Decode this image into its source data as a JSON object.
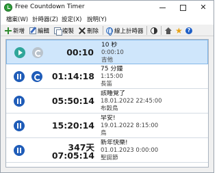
{
  "window": {
    "title": "Free Countdown Timer",
    "minimize_icon": "minimize-icon",
    "maximize_icon": "maximize-icon",
    "close_icon": "close-icon",
    "close_glyph": "✕"
  },
  "menu": {
    "items": [
      "檔案(W)",
      "計時器(Z)",
      "設定(X)",
      "說明(Y)"
    ]
  },
  "toolbar": {
    "new_label": "新增",
    "edit_label": "編輯",
    "copy_label": "複製",
    "delete_label": "刪除",
    "online_label": "線上計時器",
    "star_glyph": "★",
    "help_glyph": "?",
    "icons": [
      "plus-icon",
      "edit-icon",
      "copy-icon",
      "delete-icon",
      "globe-icon",
      "contrast-icon",
      "house-icon",
      "star-icon",
      "help-icon"
    ],
    "star_color": "#e8a317",
    "help_color": "#1e5fc7"
  },
  "timers": [
    {
      "time": "00:10",
      "name": "10 秒",
      "line2": "0:00:10",
      "line3": "吉他",
      "state": "stopped"
    },
    {
      "time": "01:14:18",
      "name": "75 分鐘",
      "line2": "1:15:00",
      "line3": "長笛",
      "state": "running"
    },
    {
      "time": "05:50:14",
      "name": "該睡覺了",
      "line2": "18.01.2022 22:45:00",
      "line3": "布穀鳥",
      "state": "running"
    },
    {
      "time": "15:20:14",
      "name": "早安!",
      "line2": "19.01.2022 8:15:00",
      "line3": "鳥",
      "state": "running"
    },
    {
      "days": "347天",
      "time": "07:05:14",
      "name": "新年快樂!",
      "line2": "01.01.2023 0:00:00",
      "line3": "聖誕節",
      "state": "running"
    }
  ],
  "colors": {
    "selected_row": "#cfe6fb",
    "play_button": "#2fa69a",
    "pause_button": "#1f5cb8",
    "reset_disabled": "#b9c3cc"
  }
}
